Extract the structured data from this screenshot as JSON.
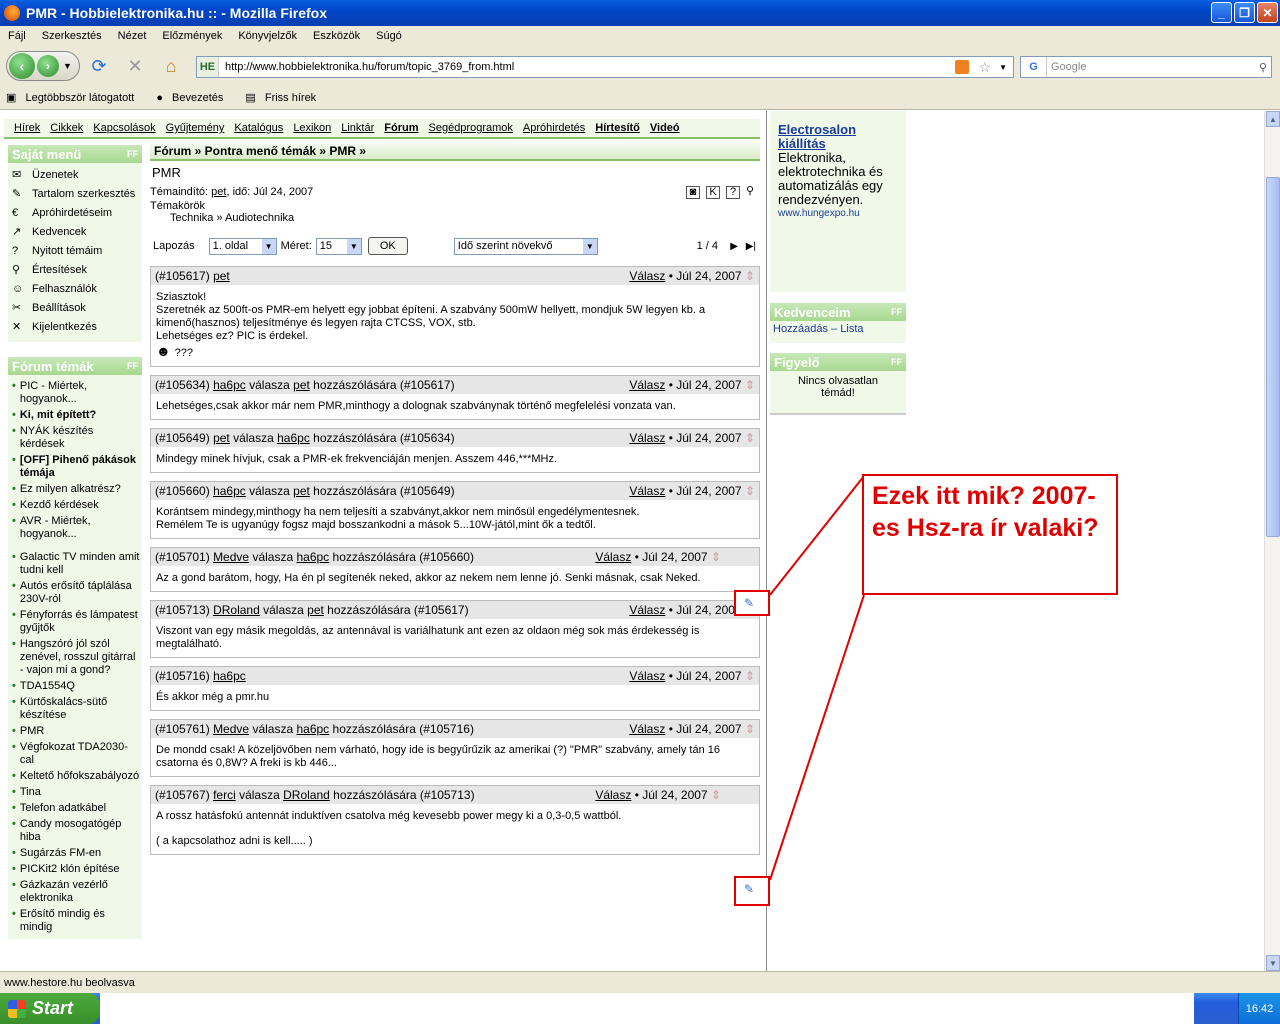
{
  "window": {
    "title": "PMR - Hobbielektronika.hu :: - Mozilla Firefox"
  },
  "menu": [
    "Fájl",
    "Szerkesztés",
    "Nézet",
    "Előzmények",
    "Könyvjelzők",
    "Eszközök",
    "Súgó"
  ],
  "url": "http://www.hobbielektronika.hu/forum/topic_3769_from.html",
  "url_icon": "HE",
  "search": {
    "placeholder": "Google"
  },
  "bookmarks": [
    "Legtöbbször látogatott",
    "Bevezetés",
    "Friss hírek"
  ],
  "topnav": [
    "Hírek",
    "Cikkek",
    "Kapcsolások",
    "Gyűjtemény",
    "Katalógus",
    "Lexikon",
    "Linktár",
    "Fórum",
    "Segédprogramok",
    "Apróhirdetés",
    "Hírtesítő",
    "Videó"
  ],
  "sajat_menu": {
    "title": "Saját menü",
    "items": [
      {
        "icon": "envelope-icon",
        "label": "Üzenetek"
      },
      {
        "icon": "edit-icon",
        "label": "Tartalom szerkesztés"
      },
      {
        "icon": "ad-icon",
        "label": "Apróhirdetéseim"
      },
      {
        "icon": "favorite-icon",
        "label": "Kedvencek"
      },
      {
        "icon": "question-icon",
        "label": "Nyitott témáim"
      },
      {
        "icon": "search-icon",
        "label": "Értesítések"
      },
      {
        "icon": "users-icon",
        "label": "Felhasználók"
      },
      {
        "icon": "tools-icon",
        "label": "Beállítások"
      },
      {
        "icon": "logout-icon",
        "label": "Kijelentkezés"
      }
    ]
  },
  "forum_temak": {
    "title": "Fórum témák",
    "items": [
      {
        "label": "PIC - Miértek, hogyanok...",
        "bold": false
      },
      {
        "label": "Ki, mit épített?",
        "bold": true
      },
      {
        "label": "NYÁK készítés kérdések",
        "bold": false
      },
      {
        "label": "[OFF] Pihenő pákások témája",
        "bold": true
      },
      {
        "label": "Ez milyen alkatrész?",
        "bold": false
      },
      {
        "label": "Kezdő kérdések",
        "bold": false
      },
      {
        "label": "AVR - Miértek, hogyanok...",
        "bold": false
      },
      {
        "label": "Galactic TV minden amit tudni kell",
        "bold": false
      },
      {
        "label": "Autós erősítő táplálása 230V-ról",
        "bold": false
      },
      {
        "label": "Fényforrás és lámpatest gyűjtők",
        "bold": false
      },
      {
        "label": "Hangszóró jól szól zenével, rosszul gitárral - vajon mi a gond?",
        "bold": false
      },
      {
        "label": "TDA1554Q",
        "bold": false
      },
      {
        "label": "Kürtőskalács-sütő készítése",
        "bold": false
      },
      {
        "label": "PMR",
        "bold": false
      },
      {
        "label": "Végfokozat TDA2030-cal",
        "bold": false
      },
      {
        "label": "Keltető hőfokszabályozó",
        "bold": false
      },
      {
        "label": "Tina",
        "bold": false
      },
      {
        "label": "Telefon adatkábel",
        "bold": false
      },
      {
        "label": "Candy mosogatógép hiba",
        "bold": false
      },
      {
        "label": "Sugárzás FM-en",
        "bold": false
      },
      {
        "label": "PICKit2 klón építése",
        "bold": false
      },
      {
        "label": "Gázkazán vezérlő elektronika",
        "bold": false
      },
      {
        "label": "Erősítő mindig és mindig",
        "bold": false
      }
    ]
  },
  "breadcrumb": "Fórum » Pontra menő témák » PMR »",
  "topic": {
    "title": "PMR",
    "starter_prefix": "Témaindító:",
    "starter": "pet",
    "date_text": ", idő: Júl 24, 2007",
    "themes_label": "Témakörök",
    "themes_path": "Technika » Audiotechnika"
  },
  "pager": {
    "label": "Lapozás",
    "page_value": "1. oldal",
    "size_label": "Méret:",
    "size_value": "15",
    "ok": "OK",
    "sort_value": "Idő szerint növekvő",
    "page_count": "1 / 4"
  },
  "reply_label": "Válasz",
  "posts": [
    {
      "id": "(#105617)",
      "author": "pet",
      "mid": "",
      "to": "",
      "ref": "",
      "date": "• Júl 24, 2007",
      "lines": [
        "Sziasztok!",
        "Szeretnék az 500ft-os PMR-em helyett egy jobbat építeni. A szabvány 500mW hellyett, mondjuk 5W legyen kb. a kimenő(hasznos) teljesítménye és legyen rajta CTCSS, VOX, stb.",
        "Lehetséges ez? PIC is érdekel."
      ],
      "extra": "???"
    },
    {
      "id": "(#105634)",
      "author": "ha6pc",
      "mid": "válasza",
      "to": "pet",
      "ref": "hozzászólására (#105617)",
      "date": "• Júl 24, 2007",
      "lines": [
        "Lehetséges,csak akkor már nem PMR,minthogy a dolognak szabványnak történő megfelelési vonzata van."
      ]
    },
    {
      "id": "(#105649)",
      "author": "pet",
      "mid": "válasza",
      "to": "ha6pc",
      "ref": "hozzászólására (#105634)",
      "date": "• Júl 24, 2007",
      "lines": [
        "Mindegy minek hívjuk, csak a PMR-ek frekvenciáján menjen. Asszem 446,***MHz."
      ]
    },
    {
      "id": "(#105660)",
      "author": "ha6pc",
      "mid": "válasza",
      "to": "pet",
      "ref": "hozzászólására (#105649)",
      "date": "• Júl 24, 2007",
      "lines": [
        "Korántsem mindegy,minthogy ha nem teljesíti a szabványt,akkor nem minősül engedélymentesnek.",
        "Remélem Te is ugyanúgy fogsz majd bosszankodni a mások 5...10W-jától,mint ők a tedtől."
      ]
    },
    {
      "id": "(#105701)",
      "author": "Medve",
      "mid": "válasza",
      "to": "ha6pc",
      "ref": "hozzászólására (#105660)",
      "date": "• Júl 24, 2007",
      "lines": [
        "Az a gond barátom, hogy, Ha én pl segítenék neked, akkor az nekem nem lenne jó. Senki másnak, csak Neked."
      ]
    },
    {
      "id": "(#105713)",
      "author": "DRoland",
      "mid": "válasza",
      "to": "pet",
      "ref": "hozzászólására (#105617)",
      "date": "• Júl 24, 2007",
      "lines": [
        "Viszont van egy másik megoldás, az antennával is variálhatunk ant ezen az oldaon még sok más érdekesség is megtalálható."
      ]
    },
    {
      "id": "(#105716)",
      "author": "ha6pc",
      "mid": "",
      "to": "",
      "ref": "",
      "date": "• Júl 24, 2007",
      "lines": [
        "És akkor még a pmr.hu"
      ]
    },
    {
      "id": "(#105761)",
      "author": "Medve",
      "mid": "válasza",
      "to": "ha6pc",
      "ref": "hozzászólására (#105716)",
      "date": "• Júl 24, 2007",
      "lines": [
        "De mondd csak! A közeljövőben nem várható, hogy ide is begyűrűzik az amerikai (?) \"PMR\" szabvány, amely tán 16 csatorna és 0,8W? A freki is kb 446..."
      ]
    },
    {
      "id": "(#105767)",
      "author": "ferci",
      "mid": "válasza",
      "to": "DRoland",
      "ref": "hozzászólására (#105713)",
      "date": "• Júl 24, 2007",
      "lines": [
        "A rossz hatásfokú antennát induktíven csatolva még kevesebb power megy ki a 0,3-0,5 wattból.",
        "( a kapcsolathoz adni is kell..... )"
      ]
    }
  ],
  "right": {
    "ad_title": "Electrosalon kiállítás",
    "ad_text": "Elektronika, elektrotechnika és automatizálás egy rendezvényen.",
    "ad_url": "www.hungexpo.hu",
    "kedvenceim_title": "Kedvenceim",
    "kedvenceim_links": "Hozzáadás – Lista",
    "figyelo_title": "Figyelő",
    "figyelo_text": "Nincs olvasatlan témád!"
  },
  "annotation": "Ezek itt mik? 2007-es Hsz-ra ír valaki?",
  "status": "www.hestore.hu beolvasva",
  "taskbar": {
    "start": "Start",
    "clock": "16:42"
  },
  "colors": {
    "annotation_red": "#e00000",
    "forum_green": "#8ac06a",
    "header_bg": "#e6e6e6"
  }
}
